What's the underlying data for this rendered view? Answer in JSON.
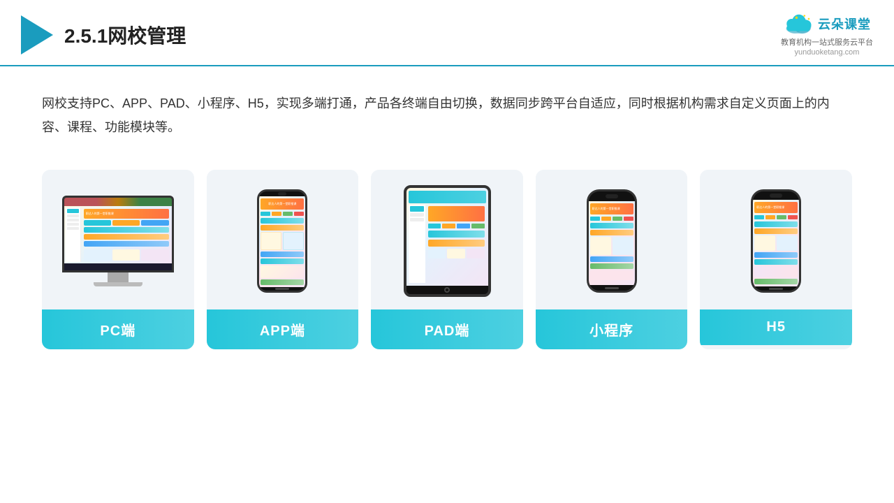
{
  "header": {
    "title": "2.5.1网校管理",
    "brand": {
      "name": "云朵课堂",
      "url": "yunduoketang.com",
      "tagline": "教育机构一站式服务云平台"
    }
  },
  "description": "网校支持PC、APP、PAD、小程序、H5，实现多端打通，产品各终端自由切换，数据同步跨平台自适应，同时根据机构需求自定义页面上的内容、课程、功能模块等。",
  "cards": [
    {
      "id": "pc",
      "label": "PC端",
      "type": "desktop"
    },
    {
      "id": "app",
      "label": "APP端",
      "type": "phone"
    },
    {
      "id": "pad",
      "label": "PAD端",
      "type": "tablet"
    },
    {
      "id": "miniapp",
      "label": "小程序",
      "type": "phone"
    },
    {
      "id": "h5",
      "label": "H5",
      "type": "phone"
    }
  ],
  "colors": {
    "accent": "#26c6da",
    "accent_dark": "#1a9cbe",
    "bg_card": "#f0f4f8"
  }
}
